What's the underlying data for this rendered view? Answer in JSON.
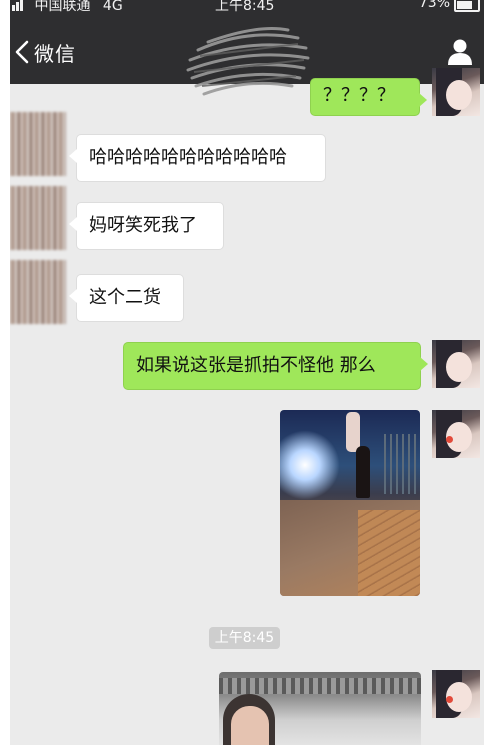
{
  "status_bar": {
    "carrier": "中国联通",
    "network": "4G",
    "time": "上午8:45",
    "battery": "73%"
  },
  "nav": {
    "back_label": "微信"
  },
  "messages": [
    {
      "side": "right",
      "text": "？？？？"
    },
    {
      "side": "left",
      "text": "哈哈哈哈哈哈哈哈哈哈哈"
    },
    {
      "side": "left",
      "text": "妈呀笑死我了"
    },
    {
      "side": "left",
      "text": "这个二货"
    },
    {
      "side": "right",
      "text": "如果说这张是抓拍不怪他 那么"
    }
  ],
  "timestamp": "上午8:45",
  "colors": {
    "nav_bg": "#2e2e30",
    "chat_bg": "#ebebeb",
    "my_bubble": "#9fe75a",
    "their_bubble": "#ffffff"
  }
}
